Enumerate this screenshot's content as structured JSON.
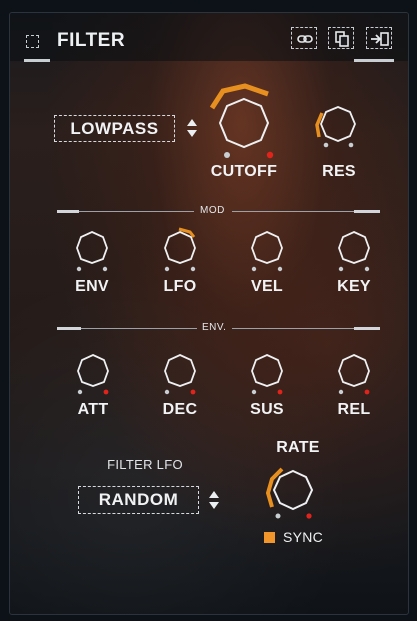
{
  "header": {
    "title": "FILTER",
    "icons": [
      "link-icon",
      "copy-icon",
      "import-icon"
    ]
  },
  "filter": {
    "type_value": "LOWPASS",
    "cutoff_label": "CUTOFF",
    "res_label": "RES"
  },
  "mod": {
    "section_label": "MOD",
    "knobs": [
      "ENV",
      "LFO",
      "VEL",
      "KEY"
    ]
  },
  "env": {
    "section_label": "ENV.",
    "knobs": [
      "ATT",
      "DEC",
      "SUS",
      "REL"
    ]
  },
  "lfo": {
    "label": "FILTER LFO",
    "shape_value": "RANDOM",
    "rate_label": "RATE",
    "sync_label": "SYNC"
  },
  "colors": {
    "accent": "#e8901f",
    "indicator_red": "#e0241c",
    "text": "#f0f2f4"
  }
}
